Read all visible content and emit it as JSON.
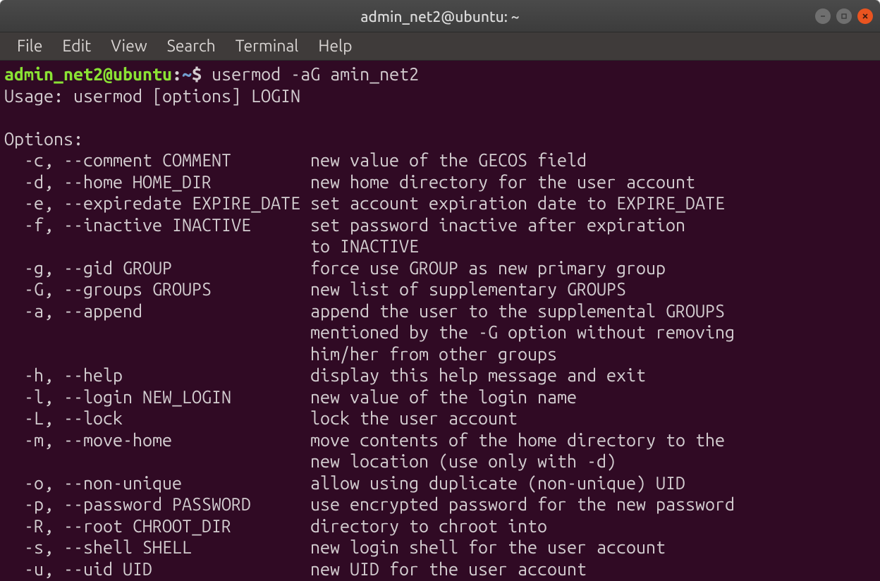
{
  "window": {
    "title": "admin_net2@ubuntu: ~"
  },
  "menu": {
    "file": "File",
    "edit": "Edit",
    "view": "View",
    "search": "Search",
    "terminal": "Terminal",
    "help": "Help"
  },
  "prompt": {
    "user_host": "admin_net2@ubuntu",
    "colon": ":",
    "path": "~",
    "dollar": "$ ",
    "command": "usermod -aG amin_net2"
  },
  "output": {
    "usage": "Usage: usermod [options] LOGIN",
    "blank": "",
    "opthdr": "Options:",
    "rows": [
      {
        "opt": "  -c, --comment COMMENT        ",
        "desc": "new value of the GECOS field"
      },
      {
        "opt": "  -d, --home HOME_DIR          ",
        "desc": "new home directory for the user account"
      },
      {
        "opt": "  -e, --expiredate EXPIRE_DATE ",
        "desc": "set account expiration date to EXPIRE_DATE"
      },
      {
        "opt": "  -f, --inactive INACTIVE      ",
        "desc": "set password inactive after expiration"
      },
      {
        "opt": "                               ",
        "desc": "to INACTIVE"
      },
      {
        "opt": "  -g, --gid GROUP              ",
        "desc": "force use GROUP as new primary group"
      },
      {
        "opt": "  -G, --groups GROUPS          ",
        "desc": "new list of supplementary GROUPS"
      },
      {
        "opt": "  -a, --append                 ",
        "desc": "append the user to the supplemental GROUPS"
      },
      {
        "opt": "                               ",
        "desc": "mentioned by the -G option without removing"
      },
      {
        "opt": "                               ",
        "desc": "him/her from other groups"
      },
      {
        "opt": "  -h, --help                   ",
        "desc": "display this help message and exit"
      },
      {
        "opt": "  -l, --login NEW_LOGIN        ",
        "desc": "new value of the login name"
      },
      {
        "opt": "  -L, --lock                   ",
        "desc": "lock the user account"
      },
      {
        "opt": "  -m, --move-home              ",
        "desc": "move contents of the home directory to the"
      },
      {
        "opt": "                               ",
        "desc": "new location (use only with -d)"
      },
      {
        "opt": "  -o, --non-unique             ",
        "desc": "allow using duplicate (non-unique) UID"
      },
      {
        "opt": "  -p, --password PASSWORD      ",
        "desc": "use encrypted password for the new password"
      },
      {
        "opt": "  -R, --root CHROOT_DIR        ",
        "desc": "directory to chroot into"
      },
      {
        "opt": "  -s, --shell SHELL            ",
        "desc": "new login shell for the user account"
      },
      {
        "opt": "  -u, --uid UID                ",
        "desc": "new UID for the user account"
      }
    ]
  }
}
